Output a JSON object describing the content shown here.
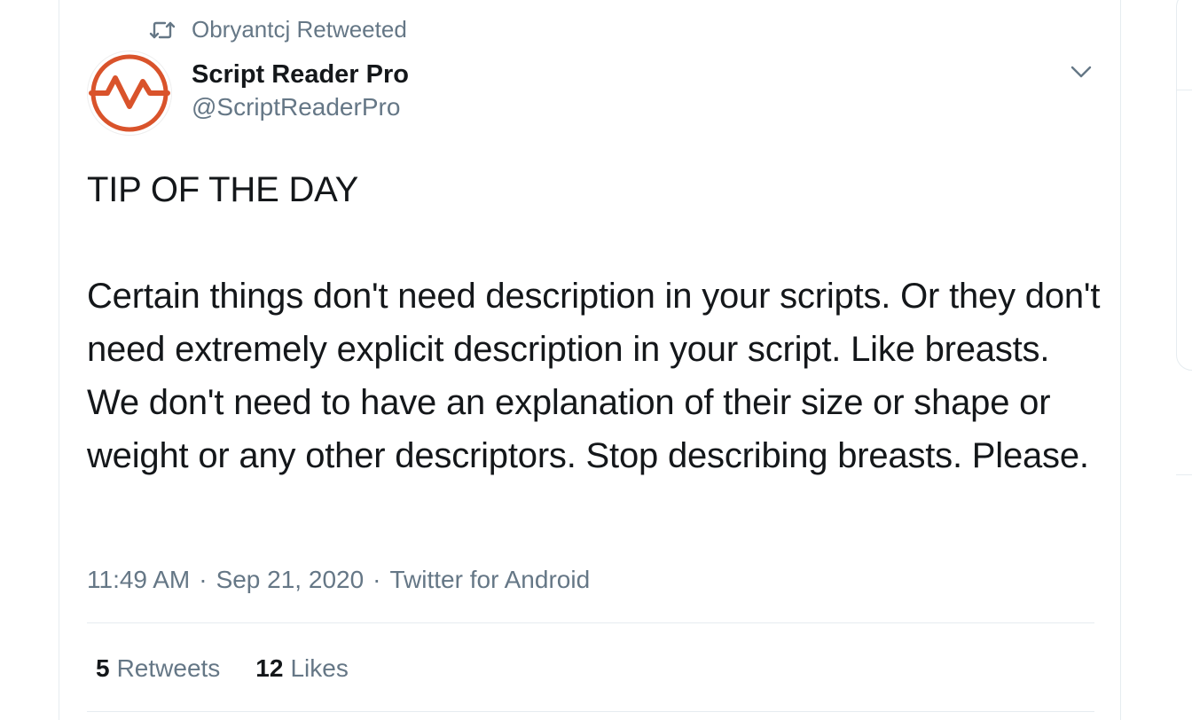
{
  "retweet_context": {
    "icon": "retweet-icon",
    "text": "Obryantcj Retweeted"
  },
  "author": {
    "avatar_icon": "pulse-logo-icon",
    "display_name": "Script Reader Pro",
    "handle": "@ScriptReaderPro"
  },
  "menu": {
    "icon": "chevron-down-icon"
  },
  "tweet": {
    "text": "TIP OF THE DAY\n\nCertain things don't need description in your scripts. Or they don't need extremely explicit description in your script. Like breasts. We don't need to have an explanation of their size or shape or weight or any other descriptors. Stop describing breasts. Please."
  },
  "meta": {
    "time": "11:49 AM",
    "separator": "·",
    "date": "Sep 21, 2020",
    "source": "Twitter for Android"
  },
  "stats": {
    "retweets_count": "5",
    "retweets_label": "Retweets",
    "likes_count": "12",
    "likes_label": "Likes"
  },
  "colors": {
    "text_primary": "#14171a",
    "text_secondary": "#657786",
    "divider": "#e6ecf0",
    "logo_orange": "#d9532b"
  }
}
